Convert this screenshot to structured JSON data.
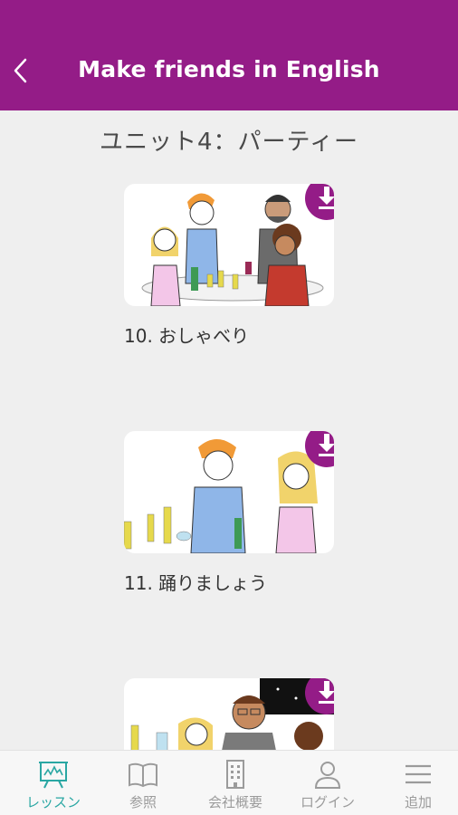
{
  "header": {
    "title": "Make friends in English",
    "back_icon": "chevron-left-icon"
  },
  "unit": {
    "title": "ユニット4：パーティー"
  },
  "lessons": [
    {
      "label": "10. おしゃべり",
      "download_icon": "download-icon"
    },
    {
      "label": "11. 踊りましょう",
      "download_icon": "download-icon"
    },
    {
      "label": "",
      "download_icon": "download-icon"
    }
  ],
  "tabs": [
    {
      "label": "レッスン",
      "icon": "presentation-board-icon",
      "active": true
    },
    {
      "label": "参照",
      "icon": "book-icon",
      "active": false
    },
    {
      "label": "会社概要",
      "icon": "building-icon",
      "active": false
    },
    {
      "label": "ログイン",
      "icon": "user-icon",
      "active": false
    },
    {
      "label": "追加",
      "icon": "menu-icon",
      "active": false
    }
  ],
  "colors": {
    "brand": "#941c87",
    "active_tab": "#2aa7a3",
    "background": "#efefef"
  }
}
